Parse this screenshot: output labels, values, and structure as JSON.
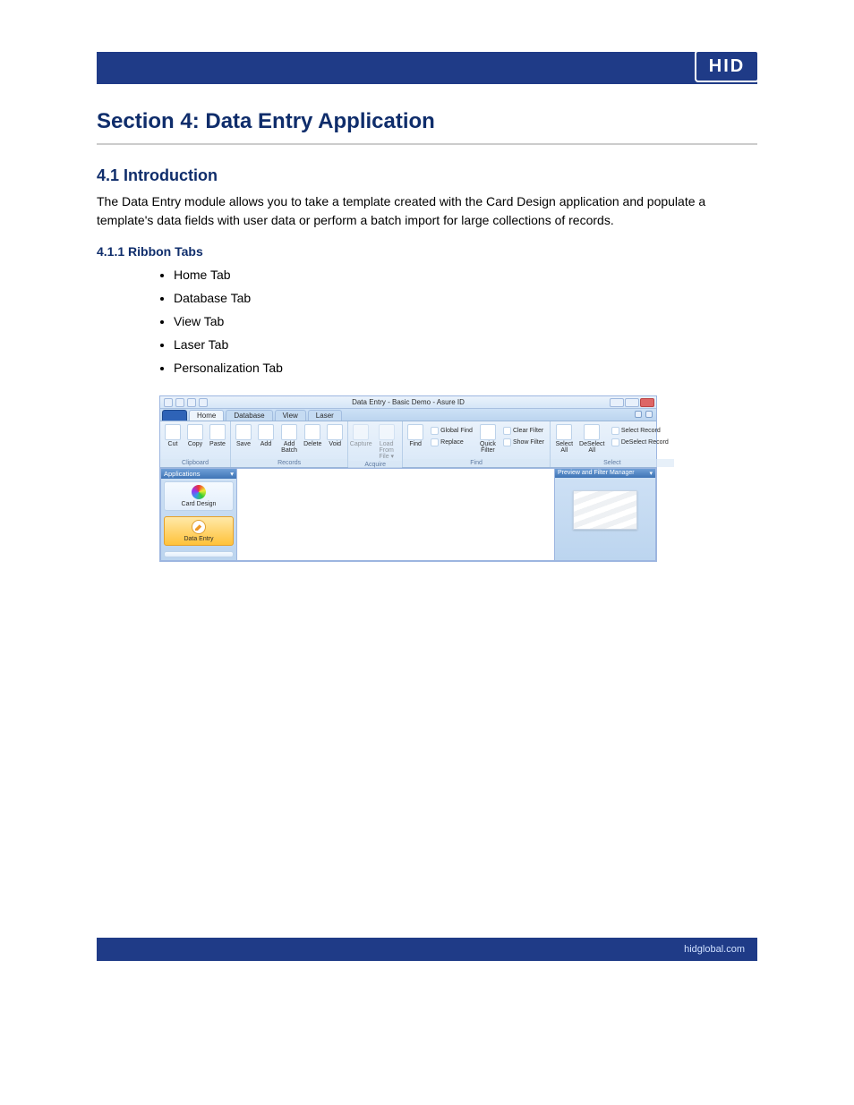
{
  "page": {
    "brand": "HID",
    "section_title": "Section 4: Data Entry Application",
    "subhead": "4.1 Introduction",
    "para": "The Data Entry module allows you to take a template created with the Card Design application and populate a template's data fields with user data or perform a batch import for large collections of records.",
    "ribbon_label": "4.1.1 Ribbon Tabs",
    "bullets": [
      "Home Tab",
      "Database Tab",
      "View Tab",
      "Laser Tab",
      "Personalization Tab"
    ],
    "footer_right": "hidglobal.com"
  },
  "app": {
    "window_title": "Data Entry - Basic Demo - Asure ID",
    "tabs": {
      "file": "",
      "home": "Home",
      "database": "Database",
      "view": "View",
      "laser": "Laser"
    },
    "groups": {
      "clipboard": {
        "label": "Clipboard",
        "cut": "Cut",
        "copy": "Copy",
        "paste": "Paste"
      },
      "records": {
        "label": "Records",
        "save": "Save",
        "add": "Add",
        "addbatch": "Add Batch",
        "delete": "Delete",
        "void": "Void"
      },
      "acquire": {
        "label": "Acquire",
        "capture": "Capture",
        "loadfile": "Load From File ▾"
      },
      "find": {
        "label": "Find",
        "find": "Find",
        "replace": "Replace",
        "quickfilter": "Quick Filter",
        "globalfind": "Global Find",
        "clearfilter": "Clear Filter",
        "showfilter": "Show Filter"
      },
      "select": {
        "label": "Select",
        "selectall": "Select All",
        "deselectall": "DeSelect All",
        "selectrecord": "Select Record",
        "deselectrecord": "DeSelect Record"
      }
    },
    "panels": {
      "applications": "Applications",
      "preview": "Preview and Filter Manager",
      "carddesign": "Card Design",
      "dataentry": "Data Entry",
      "reports": ""
    }
  }
}
